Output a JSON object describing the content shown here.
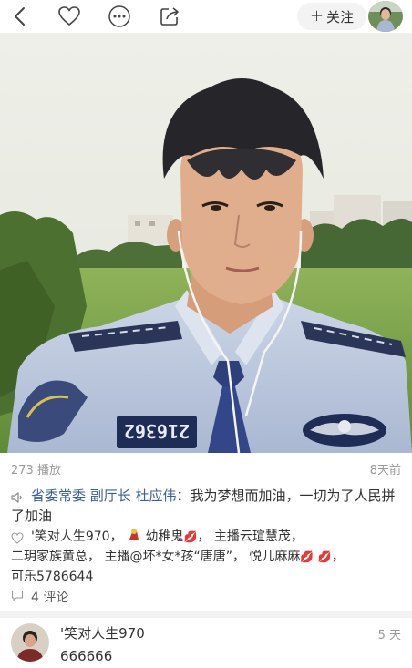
{
  "topbar": {
    "follow_label": "关注"
  },
  "post": {
    "plays": "273 播放",
    "time": "8天前",
    "caption_author": "省委常委 副厅长 杜应伟",
    "caption_text": "：我为梦想而加油，一切为了人民拼了加油",
    "patch_text": "216362",
    "likes_line1": "'笑对人生970，",
    "likes_name2": "幼稚鬼",
    "likes_line1b": "， 主播云瑄慧茂，",
    "likes_line2": "二玥家族黄总， 主播@坏*女*孩“唐唐”， 悦儿麻麻",
    "likes_line3": "，",
    "likes_line4": "可乐5786644",
    "comments": "4 评论"
  },
  "comment": {
    "name": "'笑对人生970",
    "text": "666666",
    "time": "5 天"
  }
}
